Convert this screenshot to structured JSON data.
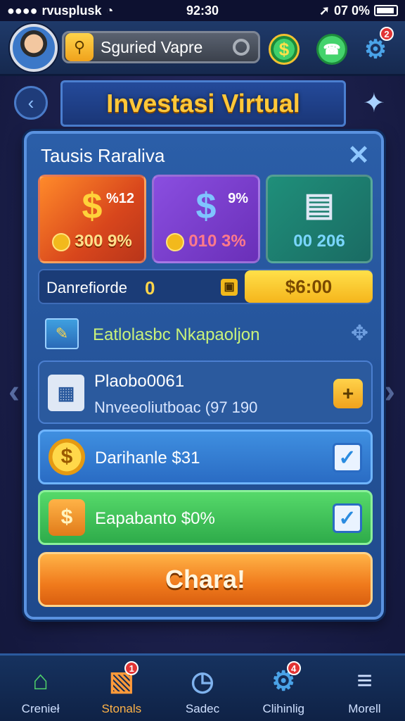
{
  "status_bar": {
    "carrier": "rvusplusk",
    "time": "92:30",
    "battery": "07 0%"
  },
  "top_bar": {
    "player_name": "Sguried Vapre",
    "settings_badge": "2",
    "coin_symbol": "$"
  },
  "header": {
    "title": "Investasi Virtual"
  },
  "panel": {
    "title": "Tausis Raraliva",
    "cards": [
      {
        "symbol": "$",
        "percent": "%12",
        "value": "300 9%"
      },
      {
        "symbol": "$",
        "percent": "9%",
        "value": "010 3%"
      },
      {
        "symbol": "",
        "percent": "",
        "value": "00 206"
      }
    ],
    "balance": {
      "label": "Danrefiorde",
      "number": "0",
      "amount": "$6:00"
    },
    "section_title": "Eatlolasbc Nkapaoljon",
    "items": [
      {
        "title": "Plaobo0061",
        "subtitle": "Nnveeoliutboac (97 190"
      },
      {
        "title": "Darihanle $31"
      },
      {
        "title": "Eapabanto $0%"
      }
    ],
    "cta_label": "Chara!"
  },
  "bottom_nav": [
    {
      "label": "Crenieł"
    },
    {
      "label": "Stonals",
      "badge": "1"
    },
    {
      "label": "Sadec"
    },
    {
      "label": "Clihinlig",
      "badge": "4"
    },
    {
      "label": "Morell"
    }
  ]
}
